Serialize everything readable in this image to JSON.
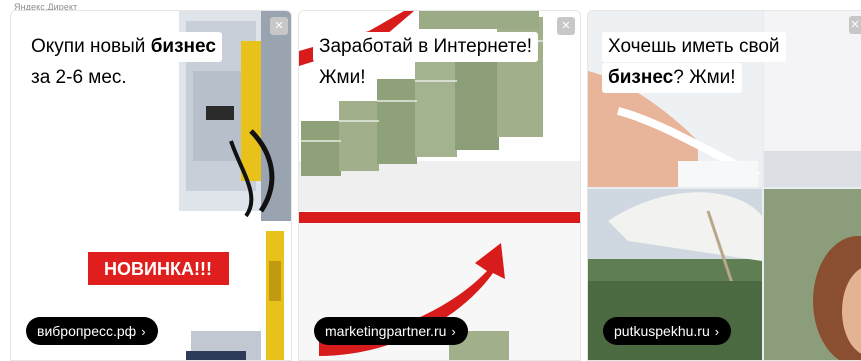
{
  "brand": "Яндекс.Директ",
  "close_glyph": "×",
  "chevron_glyph": "›",
  "ads": [
    {
      "headline_line1_pre": "Окупи новый ",
      "headline_line1_bold": "бизнес",
      "headline_line2": "за 2-6 мес.",
      "badge": "НОВИНКА!!!",
      "domain": "вибропресс.рф",
      "image_icon": "machine-photo"
    },
    {
      "headline_line1": "Заработай в Интернете!",
      "headline_line2": "Жми!",
      "domain": "marketingpartner.ru",
      "image_icon": "money-stacks-arrow-photo"
    },
    {
      "headline_line1": "Хочешь иметь свой",
      "headline_line2_bold": "бизнес",
      "headline_line2_post": "? Жми!",
      "domain": "putkuspekhu.ru",
      "image_icon": "business-people-photo"
    }
  ],
  "colors": {
    "badge_red": "#e01e1e",
    "pill_bg": "#000000",
    "close_bg": "#c7c7c7",
    "arrow_red": "#d81b1b"
  }
}
